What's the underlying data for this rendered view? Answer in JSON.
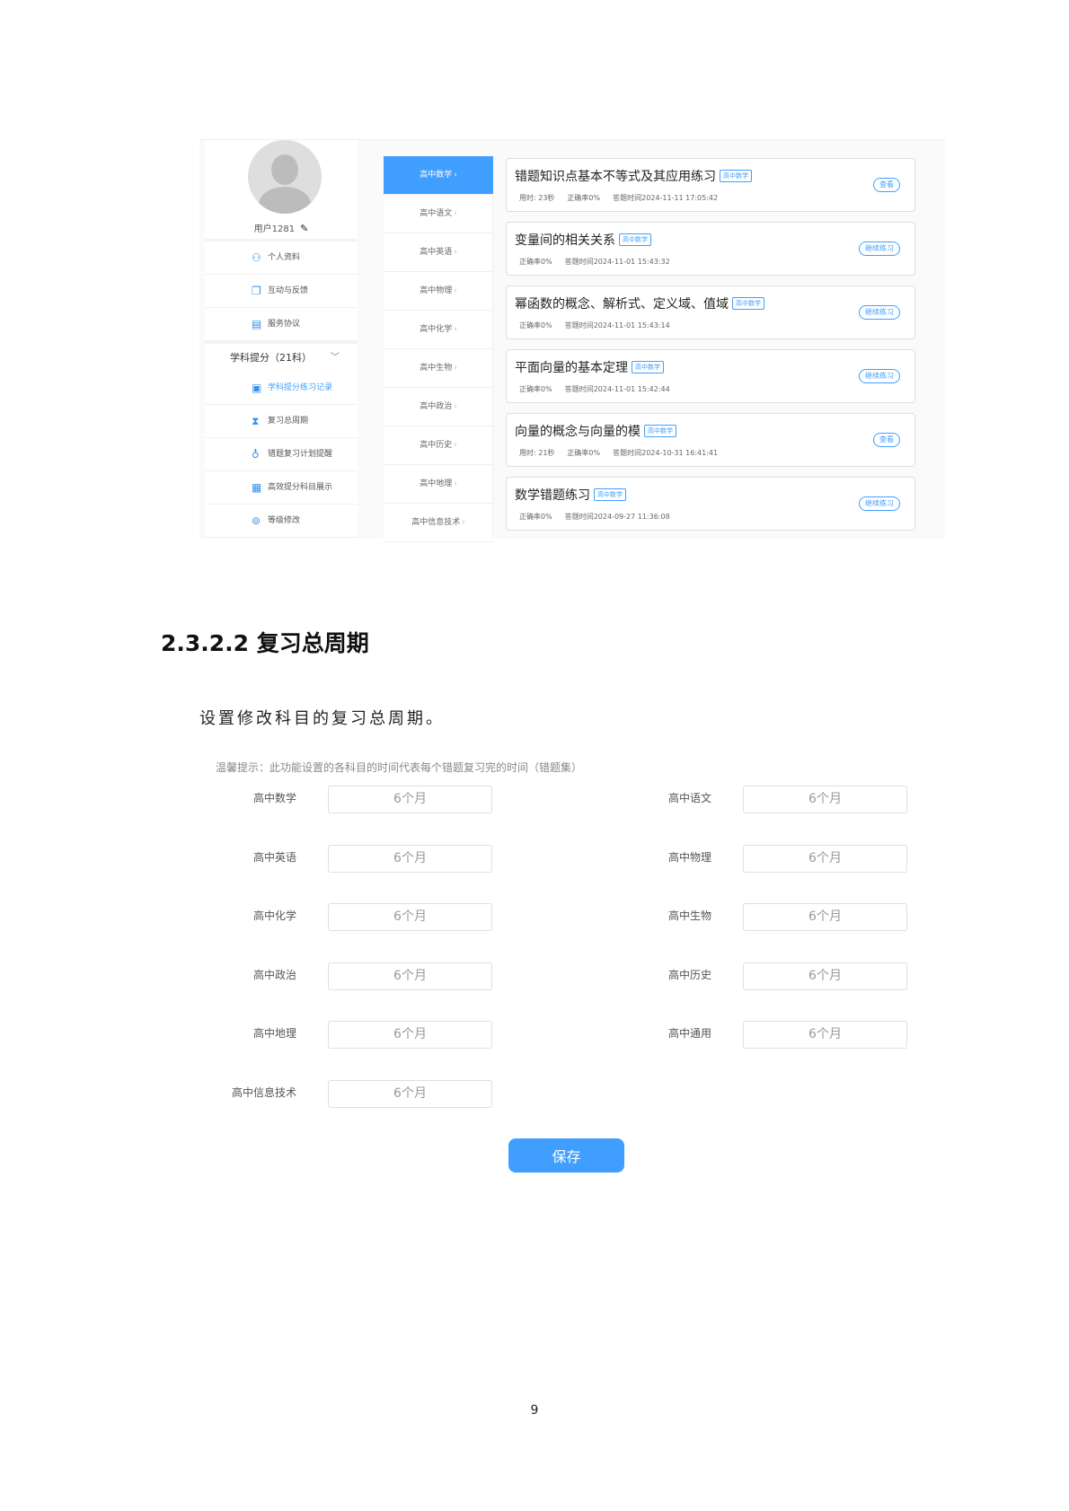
{
  "sidebar": {
    "username": "用户1281",
    "items_top": [
      {
        "icon": "user-icon",
        "label": "个人资料"
      },
      {
        "icon": "chat-icon",
        "label": "互动与反馈"
      },
      {
        "icon": "document-icon",
        "label": "服务协议"
      }
    ],
    "group_label": "学科提分（21科）",
    "items_group": [
      {
        "icon": "record-icon",
        "label": "学科提分练习记录"
      },
      {
        "icon": "hourglass-icon",
        "label": "复习总周期"
      },
      {
        "icon": "bell-icon",
        "label": "错题复习计划提醒"
      },
      {
        "icon": "display-icon",
        "label": "高效提分科目展示"
      },
      {
        "icon": "grade-icon",
        "label": "等级修改"
      }
    ]
  },
  "subjects": [
    "高中数学",
    "高中语文",
    "高中英语",
    "高中物理",
    "高中化学",
    "高中生物",
    "高中政治",
    "高中历史",
    "高中地理",
    "高中信息技术"
  ],
  "records": [
    {
      "title": "错题知识点基本不等式及其应用练习",
      "tag": "高中数学",
      "meta": [
        "用时: 23秒",
        "正确率0%",
        "答题时间2024-11-11 17:05:42"
      ],
      "button": "查看"
    },
    {
      "title": "变量间的相关关系",
      "tag": "高中数学",
      "meta": [
        "正确率0%",
        "答题时间2024-11-01 15:43:32"
      ],
      "button": "继续练习"
    },
    {
      "title": "幂函数的概念、解析式、定义域、值域",
      "tag": "高中数学",
      "meta": [
        "正确率0%",
        "答题时间2024-11-01 15:43:14"
      ],
      "button": "继续练习"
    },
    {
      "title": "平面向量的基本定理",
      "tag": "高中数学",
      "meta": [
        "正确率0%",
        "答题时间2024-11-01 15:42:44"
      ],
      "button": "继续练习"
    },
    {
      "title": "向量的概念与向量的模",
      "tag": "高中数学",
      "meta": [
        "用时: 21秒",
        "正确率0%",
        "答题时间2024-10-31 16:41:41"
      ],
      "button": "查看"
    },
    {
      "title": "数学错题练习",
      "tag": "高中数学",
      "meta": [
        "正确率0%",
        "答题时间2024-09-27 11:36:08"
      ],
      "button": "继续练习"
    }
  ],
  "doc": {
    "heading": "2.3.2.2 复习总周期",
    "paragraph": "设置修改科目的复习总周期。",
    "page_number": "9"
  },
  "form": {
    "hint": "温馨提示：此功能设置的各科目的时间代表每个错题复习完的时间（错题集）",
    "fields": [
      {
        "label": "高中数学",
        "value": "6个月"
      },
      {
        "label": "高中语文",
        "value": "6个月"
      },
      {
        "label": "高中英语",
        "value": "6个月"
      },
      {
        "label": "高中物理",
        "value": "6个月"
      },
      {
        "label": "高中化学",
        "value": "6个月"
      },
      {
        "label": "高中生物",
        "value": "6个月"
      },
      {
        "label": "高中政治",
        "value": "6个月"
      },
      {
        "label": "高中历史",
        "value": "6个月"
      },
      {
        "label": "高中地理",
        "value": "6个月"
      },
      {
        "label": "高中通用",
        "value": "6个月"
      },
      {
        "label": "高中信息技术",
        "value": "6个月"
      }
    ],
    "save_label": "保存"
  },
  "colors": {
    "accent": "#409eff",
    "border": "#dcdfe6",
    "muted_text": "#888888"
  }
}
